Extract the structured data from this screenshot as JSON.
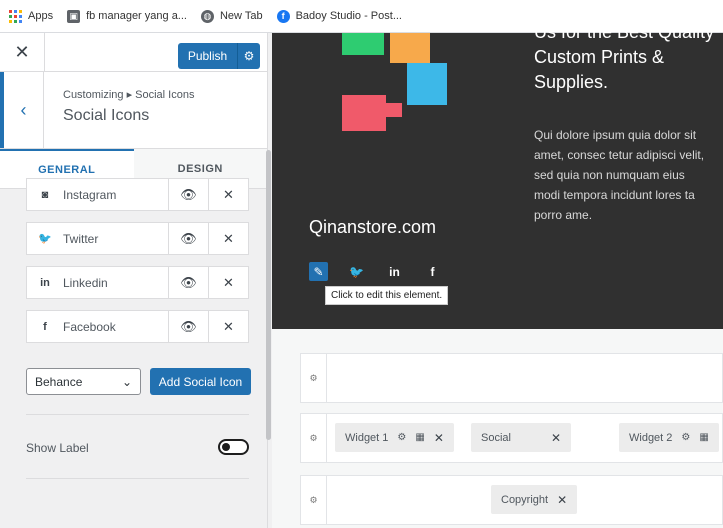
{
  "bookmarks": [
    {
      "label": "Apps",
      "icon": "apps-grid-icon"
    },
    {
      "label": "fb manager yang a...",
      "icon": "bookmark-page-icon"
    },
    {
      "label": "New Tab",
      "icon": "globe-icon"
    },
    {
      "label": "Badoy Studio - Post...",
      "icon": "facebook-icon"
    }
  ],
  "topbar": {
    "publish_label": "Publish"
  },
  "section": {
    "breadcrumb": "Customizing ▸ Social Icons",
    "title": "Social Icons"
  },
  "tabs": [
    {
      "label": "GENERAL"
    },
    {
      "label": "DESIGN"
    }
  ],
  "social_items": [
    {
      "name": "Instagram",
      "icon": "◙"
    },
    {
      "name": "Twitter",
      "icon": "🐦"
    },
    {
      "name": "Linkedin",
      "icon": "in"
    },
    {
      "name": "Facebook",
      "icon": "f"
    }
  ],
  "add": {
    "select_value": "Behance",
    "button_label": "Add Social Icon"
  },
  "show_label": {
    "label": "Show Label",
    "enabled": false
  },
  "preview": {
    "site_name": "Qinanstore.com",
    "tagline": "Us for the Best Quality Custom Prints & Supplies.",
    "description": "Qui dolore ipsum quia dolor sit amet, consec tetur adipisci velit, sed quia non numquam eius modi tempora incidunt lores ta porro ame.",
    "tooltip": "Click to edit this element.",
    "chips": {
      "widget1": "Widget 1",
      "social": "Social",
      "widget2": "Widget 2",
      "copyright": "Copyright"
    }
  },
  "colors": {
    "accent": "#2271b1",
    "hero_bg": "#303030"
  }
}
